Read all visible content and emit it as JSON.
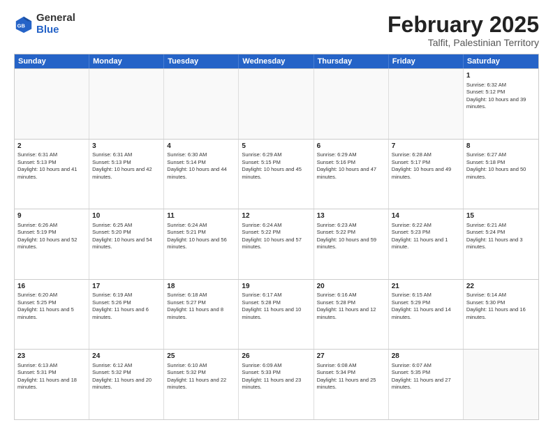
{
  "logo": {
    "general": "General",
    "blue": "Blue"
  },
  "header": {
    "title": "February 2025",
    "subtitle": "Talfit, Palestinian Territory"
  },
  "weekdays": [
    "Sunday",
    "Monday",
    "Tuesday",
    "Wednesday",
    "Thursday",
    "Friday",
    "Saturday"
  ],
  "weeks": [
    [
      {
        "day": "",
        "text": ""
      },
      {
        "day": "",
        "text": ""
      },
      {
        "day": "",
        "text": ""
      },
      {
        "day": "",
        "text": ""
      },
      {
        "day": "",
        "text": ""
      },
      {
        "day": "",
        "text": ""
      },
      {
        "day": "1",
        "text": "Sunrise: 6:32 AM\nSunset: 5:12 PM\nDaylight: 10 hours and 39 minutes."
      }
    ],
    [
      {
        "day": "2",
        "text": "Sunrise: 6:31 AM\nSunset: 5:13 PM\nDaylight: 10 hours and 41 minutes."
      },
      {
        "day": "3",
        "text": "Sunrise: 6:31 AM\nSunset: 5:13 PM\nDaylight: 10 hours and 42 minutes."
      },
      {
        "day": "4",
        "text": "Sunrise: 6:30 AM\nSunset: 5:14 PM\nDaylight: 10 hours and 44 minutes."
      },
      {
        "day": "5",
        "text": "Sunrise: 6:29 AM\nSunset: 5:15 PM\nDaylight: 10 hours and 45 minutes."
      },
      {
        "day": "6",
        "text": "Sunrise: 6:29 AM\nSunset: 5:16 PM\nDaylight: 10 hours and 47 minutes."
      },
      {
        "day": "7",
        "text": "Sunrise: 6:28 AM\nSunset: 5:17 PM\nDaylight: 10 hours and 49 minutes."
      },
      {
        "day": "8",
        "text": "Sunrise: 6:27 AM\nSunset: 5:18 PM\nDaylight: 10 hours and 50 minutes."
      }
    ],
    [
      {
        "day": "9",
        "text": "Sunrise: 6:26 AM\nSunset: 5:19 PM\nDaylight: 10 hours and 52 minutes."
      },
      {
        "day": "10",
        "text": "Sunrise: 6:25 AM\nSunset: 5:20 PM\nDaylight: 10 hours and 54 minutes."
      },
      {
        "day": "11",
        "text": "Sunrise: 6:24 AM\nSunset: 5:21 PM\nDaylight: 10 hours and 56 minutes."
      },
      {
        "day": "12",
        "text": "Sunrise: 6:24 AM\nSunset: 5:22 PM\nDaylight: 10 hours and 57 minutes."
      },
      {
        "day": "13",
        "text": "Sunrise: 6:23 AM\nSunset: 5:22 PM\nDaylight: 10 hours and 59 minutes."
      },
      {
        "day": "14",
        "text": "Sunrise: 6:22 AM\nSunset: 5:23 PM\nDaylight: 11 hours and 1 minute."
      },
      {
        "day": "15",
        "text": "Sunrise: 6:21 AM\nSunset: 5:24 PM\nDaylight: 11 hours and 3 minutes."
      }
    ],
    [
      {
        "day": "16",
        "text": "Sunrise: 6:20 AM\nSunset: 5:25 PM\nDaylight: 11 hours and 5 minutes."
      },
      {
        "day": "17",
        "text": "Sunrise: 6:19 AM\nSunset: 5:26 PM\nDaylight: 11 hours and 6 minutes."
      },
      {
        "day": "18",
        "text": "Sunrise: 6:18 AM\nSunset: 5:27 PM\nDaylight: 11 hours and 8 minutes."
      },
      {
        "day": "19",
        "text": "Sunrise: 6:17 AM\nSunset: 5:28 PM\nDaylight: 11 hours and 10 minutes."
      },
      {
        "day": "20",
        "text": "Sunrise: 6:16 AM\nSunset: 5:28 PM\nDaylight: 11 hours and 12 minutes."
      },
      {
        "day": "21",
        "text": "Sunrise: 6:15 AM\nSunset: 5:29 PM\nDaylight: 11 hours and 14 minutes."
      },
      {
        "day": "22",
        "text": "Sunrise: 6:14 AM\nSunset: 5:30 PM\nDaylight: 11 hours and 16 minutes."
      }
    ],
    [
      {
        "day": "23",
        "text": "Sunrise: 6:13 AM\nSunset: 5:31 PM\nDaylight: 11 hours and 18 minutes."
      },
      {
        "day": "24",
        "text": "Sunrise: 6:12 AM\nSunset: 5:32 PM\nDaylight: 11 hours and 20 minutes."
      },
      {
        "day": "25",
        "text": "Sunrise: 6:10 AM\nSunset: 5:32 PM\nDaylight: 11 hours and 22 minutes."
      },
      {
        "day": "26",
        "text": "Sunrise: 6:09 AM\nSunset: 5:33 PM\nDaylight: 11 hours and 23 minutes."
      },
      {
        "day": "27",
        "text": "Sunrise: 6:08 AM\nSunset: 5:34 PM\nDaylight: 11 hours and 25 minutes."
      },
      {
        "day": "28",
        "text": "Sunrise: 6:07 AM\nSunset: 5:35 PM\nDaylight: 11 hours and 27 minutes."
      },
      {
        "day": "",
        "text": ""
      }
    ]
  ]
}
